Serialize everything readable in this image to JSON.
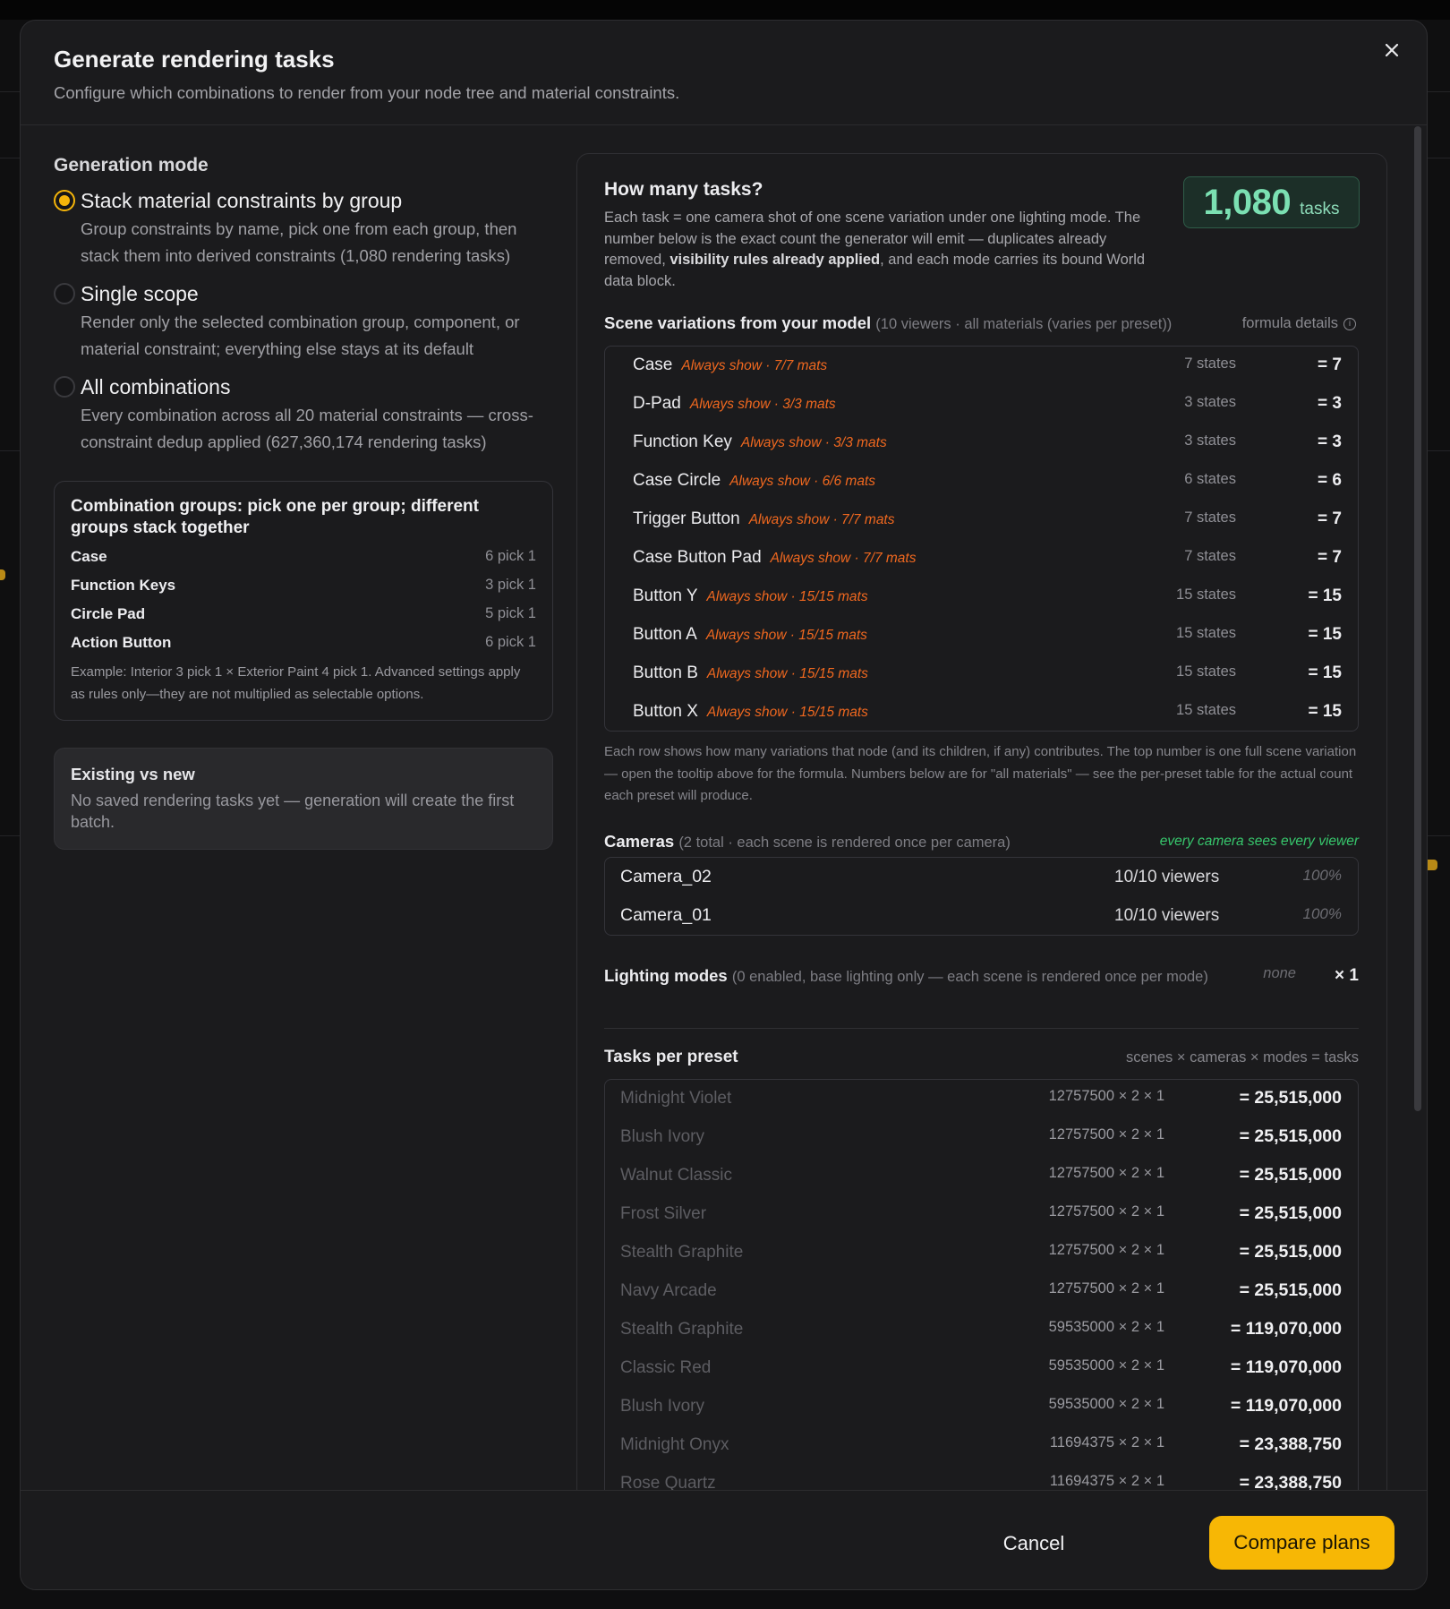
{
  "modal": {
    "title": "Generate rendering tasks",
    "subtitle": "Configure which combinations to render from your node tree and material constraints."
  },
  "generation_mode": {
    "title": "Generation mode",
    "options": [
      {
        "label": "Stack material constraints by group",
        "description": "Group constraints by name, pick one from each group, then stack them into derived constraints (1,080 rendering tasks)",
        "selected": true
      },
      {
        "label": "Single scope",
        "description": "Render only the selected combination group, component, or material constraint; everything else stays at its default",
        "selected": false
      },
      {
        "label": "All combinations",
        "description": "Every combination across all 20 material constraints — cross-constraint dedup applied (627,360,174 rendering tasks)",
        "selected": false
      }
    ]
  },
  "combination_groups": {
    "title": "Combination groups: pick one per group; different groups stack together",
    "groups": [
      {
        "name": "Case",
        "pick": "6 pick 1"
      },
      {
        "name": "Function Keys",
        "pick": "3 pick 1"
      },
      {
        "name": "Circle Pad",
        "pick": "5 pick 1"
      },
      {
        "name": "Action Button",
        "pick": "6 pick 1"
      }
    ],
    "note": "Example: Interior 3 pick 1 × Exterior Paint 4 pick 1. Advanced settings apply as rules only—they are not multiplied as selectable options."
  },
  "existing": {
    "title": "Existing vs new",
    "text": "No saved rendering tasks yet — generation will create the first batch."
  },
  "how_many": {
    "title": "How many tasks?",
    "text_before": "Each task = one camera shot of one scene variation under one lighting mode. The number below is the exact count the generator will emit — duplicates already removed, ",
    "text_bold": "visibility rules already applied",
    "text_after": ", and each mode carries its bound World data block.",
    "count": "1,080",
    "count_unit": "tasks"
  },
  "scene_variations": {
    "title": "Scene variations from your model",
    "meta": "(10 viewers · all materials (varies per preset))",
    "formula_link": "formula details",
    "rows": [
      {
        "name": "Case",
        "visibility": "Always show · 7/7 mats",
        "states": "7 states",
        "total": "= 7"
      },
      {
        "name": "D-Pad",
        "visibility": "Always show · 3/3 mats",
        "states": "3 states",
        "total": "= 3"
      },
      {
        "name": "Function Key",
        "visibility": "Always show · 3/3 mats",
        "states": "3 states",
        "total": "= 3"
      },
      {
        "name": "Case Circle",
        "visibility": "Always show · 6/6 mats",
        "states": "6 states",
        "total": "= 6"
      },
      {
        "name": "Trigger Button",
        "visibility": "Always show · 7/7 mats",
        "states": "7 states",
        "total": "= 7"
      },
      {
        "name": "Case Button Pad",
        "visibility": "Always show · 7/7 mats",
        "states": "7 states",
        "total": "= 7"
      },
      {
        "name": "Button Y",
        "visibility": "Always show · 15/15 mats",
        "states": "15 states",
        "total": "= 15"
      },
      {
        "name": "Button A",
        "visibility": "Always show · 15/15 mats",
        "states": "15 states",
        "total": "= 15"
      },
      {
        "name": "Button B",
        "visibility": "Always show · 15/15 mats",
        "states": "15 states",
        "total": "= 15"
      },
      {
        "name": "Button X",
        "visibility": "Always show · 15/15 mats",
        "states": "15 states",
        "total": "= 15"
      }
    ],
    "note": "Each row shows how many variations that node (and its children, if any) contributes. The top number is one full scene variation — open the tooltip above for the formula. Numbers below are for \"all materials\" — see the per-preset table for the actual count each preset will produce."
  },
  "cameras": {
    "title": "Cameras",
    "meta": "(2 total · each scene is rendered once per camera)",
    "coverage": "every camera sees every viewer",
    "rows": [
      {
        "name": "Camera_02",
        "viewers": "10/10 viewers",
        "pct": "100%"
      },
      {
        "name": "Camera_01",
        "viewers": "10/10 viewers",
        "pct": "100%"
      }
    ]
  },
  "lighting": {
    "title": "Lighting modes",
    "meta": "(0 enabled, base lighting only — each scene is rendered once per mode)",
    "none": "none",
    "multiplier": "× 1"
  },
  "tasks_per_preset": {
    "title": "Tasks per preset",
    "formula": "scenes × cameras × modes = tasks",
    "rows": [
      {
        "name": "Midnight Violet",
        "expr": "12757500 × 2 × 1",
        "total": "= 25,515,000"
      },
      {
        "name": "Blush Ivory",
        "expr": "12757500 × 2 × 1",
        "total": "= 25,515,000"
      },
      {
        "name": "Walnut Classic",
        "expr": "12757500 × 2 × 1",
        "total": "= 25,515,000"
      },
      {
        "name": "Frost Silver",
        "expr": "12757500 × 2 × 1",
        "total": "= 25,515,000"
      },
      {
        "name": "Stealth Graphite",
        "expr": "12757500 × 2 × 1",
        "total": "= 25,515,000"
      },
      {
        "name": "Navy Arcade",
        "expr": "12757500 × 2 × 1",
        "total": "= 25,515,000"
      },
      {
        "name": "Stealth Graphite",
        "expr": "59535000 × 2 × 1",
        "total": "= 119,070,000"
      },
      {
        "name": "Classic Red",
        "expr": "59535000 × 2 × 1",
        "total": "= 119,070,000"
      },
      {
        "name": "Blush Ivory",
        "expr": "59535000 × 2 × 1",
        "total": "= 119,070,000"
      },
      {
        "name": "Midnight Onyx",
        "expr": "11694375 × 2 × 1",
        "total": "= 23,388,750"
      },
      {
        "name": "Rose Quartz",
        "expr": "11694375 × 2 × 1",
        "total": "= 23,388,750"
      }
    ]
  },
  "footer": {
    "cancel_label": "Cancel",
    "primary_label": "Compare plans"
  },
  "colors": {
    "accent": "#f7b705",
    "success": "#7be0b2",
    "visibility": "#f0681f",
    "coverage": "#37c66c"
  }
}
